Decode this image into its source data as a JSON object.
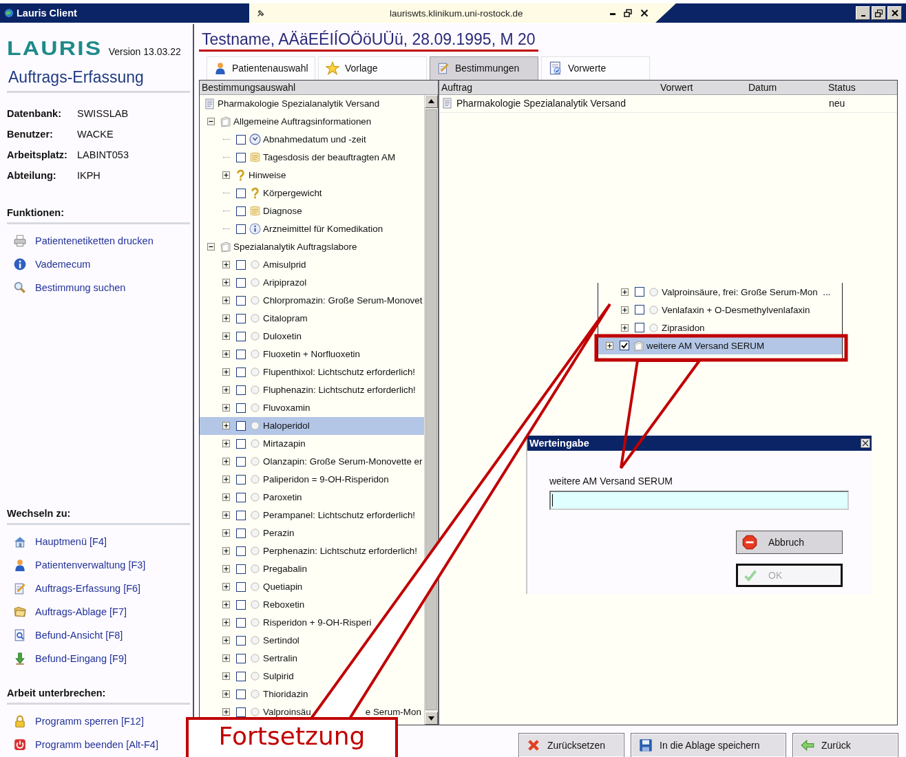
{
  "window": {
    "title": "Lauris Client",
    "address": "lauriswts.klinikum.uni-rostock.de"
  },
  "sidebar": {
    "logo": "LAURIS",
    "version": "Version 13.03.22",
    "module": "Auftrags-Erfassung",
    "info": [
      {
        "label": "Datenbank:",
        "value": "SWISSLAB"
      },
      {
        "label": "Benutzer:",
        "value": "WACKE"
      },
      {
        "label": "Arbeitsplatz:",
        "value": "LABINT053"
      },
      {
        "label": "Abteilung:",
        "value": "IKPH"
      }
    ],
    "sections": [
      {
        "title": "Funktionen:",
        "items": [
          "Patientenetiketten drucken",
          "Vademecum",
          "Bestimmung suchen"
        ]
      },
      {
        "title": "Wechseln zu:",
        "items": [
          "Hauptmenü [F4]",
          "Patientenverwaltung [F3]",
          "Auftrags-Erfassung [F6]",
          "Auftrags-Ablage [F7]",
          "Befund-Ansicht [F8]",
          "Befund-Eingang [F9]"
        ]
      },
      {
        "title": "Arbeit unterbrechen:",
        "items": [
          "Programm sperren [F12]",
          "Programm beenden [Alt-F4]"
        ]
      }
    ]
  },
  "patient": {
    "header": "Testname, AÄäEÉIÍOÖöUÜü, 28.09.1995, M 20"
  },
  "tabs": [
    {
      "label": "Patientenauswahl",
      "selected": false
    },
    {
      "label": "Vorlage",
      "selected": false
    },
    {
      "label": "Bestimmungen",
      "selected": true
    },
    {
      "label": "Vorwerte",
      "selected": false
    }
  ],
  "selection_tree": {
    "heading": "Bestimmungsauswahl",
    "root": "Pharmakologie Spezialanalytik Versand",
    "groups": [
      {
        "label": "Allgemeine Auftragsinformationen",
        "kind": "group",
        "expanded": true,
        "selected": false,
        "children": [
          {
            "label": "Abnahmedatum und -zeit",
            "kind": "date",
            "checked": false,
            "selected": false
          },
          {
            "label": "Tagesdosis der beauftragten AM",
            "kind": "note",
            "checked": false,
            "selected": false
          },
          {
            "label": "Hinweise",
            "kind": "hint",
            "expanded": false,
            "selected": false
          },
          {
            "label": "Körpergewicht",
            "kind": "hint",
            "checked": false,
            "selected": false
          },
          {
            "label": "Diagnose",
            "kind": "note",
            "checked": false,
            "selected": false
          },
          {
            "label": "Arzneimittel für Komedikation",
            "kind": "info",
            "checked": false,
            "selected": false
          }
        ]
      },
      {
        "label": "Spezialanalytik Auftragslabore",
        "kind": "group",
        "expanded": true,
        "selected": false,
        "children": [
          {
            "label": "Amisulprid",
            "kind": "analysis",
            "expanded": false,
            "checked": false,
            "selected": false
          },
          {
            "label": "Aripiprazol",
            "kind": "analysis",
            "expanded": false,
            "checked": false,
            "selected": false
          },
          {
            "label": "Chlorpromazin: Große Serum-Monovet",
            "kind": "analysis",
            "expanded": false,
            "checked": false,
            "selected": false
          },
          {
            "label": "Citalopram",
            "kind": "analysis",
            "expanded": false,
            "checked": false,
            "selected": false
          },
          {
            "label": "Duloxetin",
            "kind": "analysis",
            "expanded": false,
            "checked": false,
            "selected": false
          },
          {
            "label": "Fluoxetin + Norfluoxetin",
            "kind": "analysis",
            "expanded": false,
            "checked": false,
            "selected": false
          },
          {
            "label": "Flupenthixol: Lichtschutz erforderlich!",
            "kind": "analysis",
            "expanded": false,
            "checked": false,
            "selected": false
          },
          {
            "label": "Fluphenazin: Lichtschutz erforderlich!",
            "kind": "analysis",
            "expanded": false,
            "checked": false,
            "selected": false
          },
          {
            "label": "Fluvoxamin",
            "kind": "analysis",
            "expanded": false,
            "checked": false,
            "selected": false
          },
          {
            "label": "Haloperidol",
            "kind": "analysis",
            "expanded": false,
            "checked": false,
            "selected": true
          },
          {
            "label": "Mirtazapin",
            "kind": "analysis",
            "expanded": false,
            "checked": false,
            "selected": false
          },
          {
            "label": "Olanzapin: Große Serum-Monovette er",
            "kind": "analysis",
            "expanded": false,
            "checked": false,
            "selected": false
          },
          {
            "label": "Paliperidon = 9-OH-Risperidon",
            "kind": "analysis",
            "expanded": false,
            "checked": false,
            "selected": false
          },
          {
            "label": "Paroxetin",
            "kind": "analysis",
            "expanded": false,
            "checked": false,
            "selected": false
          },
          {
            "label": "Perampanel: Lichtschutz erforderlich!",
            "kind": "analysis",
            "expanded": false,
            "checked": false,
            "selected": false
          },
          {
            "label": "Perazin",
            "kind": "analysis",
            "expanded": false,
            "checked": false,
            "selected": false
          },
          {
            "label": "Perphenazin: Lichtschutz erforderlich!",
            "kind": "analysis",
            "expanded": false,
            "checked": false,
            "selected": false
          },
          {
            "label": "Pregabalin",
            "kind": "analysis",
            "expanded": false,
            "checked": false,
            "selected": false
          },
          {
            "label": "Quetiapin",
            "kind": "analysis",
            "expanded": false,
            "checked": false,
            "selected": false
          },
          {
            "label": "Reboxetin",
            "kind": "analysis",
            "expanded": false,
            "checked": false,
            "selected": false
          },
          {
            "label": "Risperidon + 9-OH-Risperi",
            "kind": "analysis",
            "expanded": false,
            "checked": false,
            "selected": false
          },
          {
            "label": "Sertindol",
            "kind": "analysis",
            "expanded": false,
            "checked": false,
            "selected": false
          },
          {
            "label": "Sertralin",
            "kind": "analysis",
            "expanded": false,
            "checked": false,
            "selected": false
          },
          {
            "label": "Sulpirid",
            "kind": "analysis",
            "expanded": false,
            "checked": false,
            "selected": false
          },
          {
            "label": "Thioridazin",
            "kind": "analysis",
            "expanded": false,
            "checked": false,
            "selected": false
          },
          {
            "label": "Valproinsäu",
            "label_tail": "e Serum-Mon",
            "kind": "analysis",
            "expanded": false,
            "checked": false,
            "selected": false
          }
        ]
      }
    ]
  },
  "order_table": {
    "columns": [
      "Auftrag",
      "Vorwert",
      "Datum",
      "Status"
    ],
    "rows": [
      {
        "auftrag": "Pharmakologie Spezialanalytik Versand",
        "status": "neu"
      }
    ]
  },
  "tree_inset": {
    "children": [
      {
        "label": "Valproinsäure, frei: Große Serum-Mon  ...",
        "kind": "analysis",
        "expanded": false,
        "checked": false,
        "selected": false
      },
      {
        "label": "Venlafaxin + O-Desmethylvenlafaxin",
        "kind": "analysis",
        "expanded": false,
        "checked": false,
        "selected": false
      },
      {
        "label": "Ziprasidon",
        "kind": "analysis",
        "expanded": false,
        "checked": false,
        "selected": false
      }
    ],
    "groups": [
      {
        "label": "weitere AM Versand SERUM",
        "kind": "group",
        "expanded": false,
        "checked": true,
        "selected": true
      }
    ]
  },
  "dialog": {
    "title": "Werteingabe",
    "field_label": "weitere AM Versand SERUM",
    "buttons": [
      {
        "label": "Abbruch",
        "disabled": false
      },
      {
        "label": "OK",
        "disabled": true
      }
    ]
  },
  "actions": [
    "Zurücksetzen",
    "In die Ablage speichern",
    "Zurück"
  ],
  "callout": {
    "label": "Fortsetzung"
  }
}
